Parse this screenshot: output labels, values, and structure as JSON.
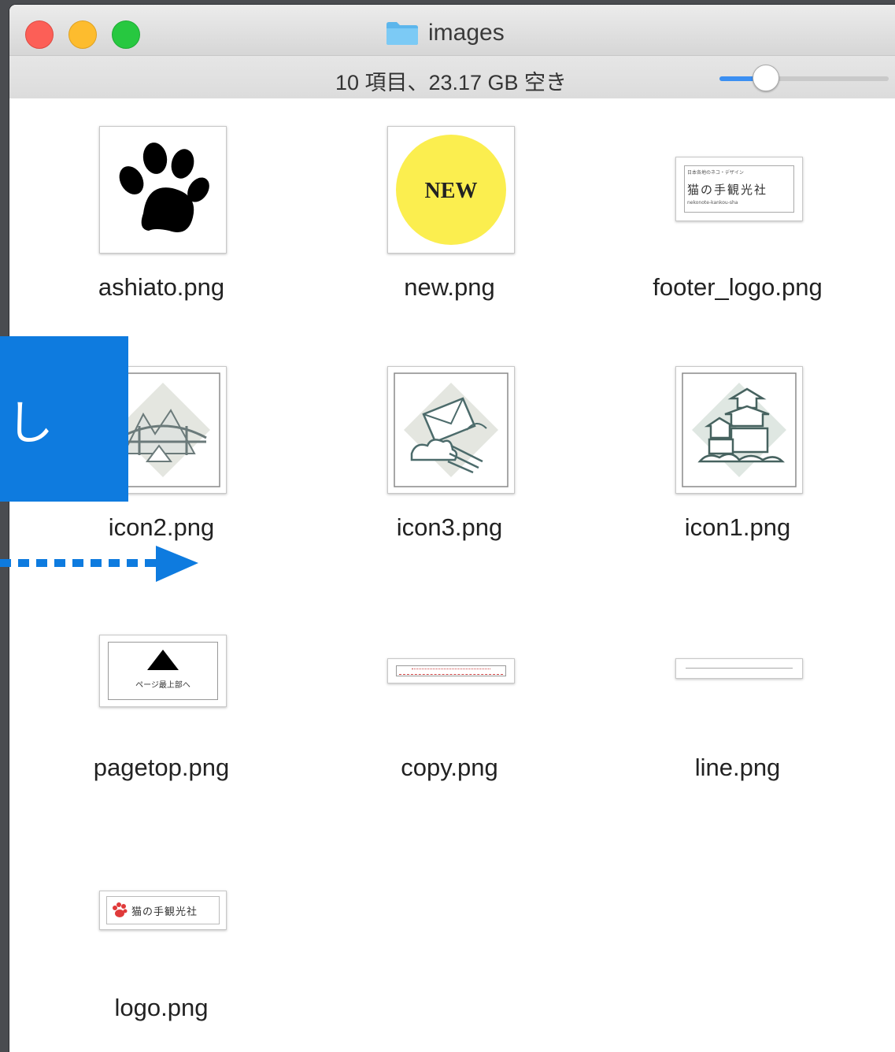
{
  "window": {
    "title": "images",
    "status": "10 項目、23.17 GB 空き",
    "zoom_fraction": 0.27
  },
  "overlay": {
    "text": "し",
    "color": "#0e7bdf"
  },
  "files": [
    {
      "name": "ashiato.png",
      "icon": "paw-print-icon"
    },
    {
      "name": "new.png",
      "icon": "new-badge-icon",
      "badge_text": "NEW"
    },
    {
      "name": "footer_logo.png",
      "icon": "footer-logo-thumbnail"
    },
    {
      "name": "icon2.png",
      "icon": "bridge-mountains-icon"
    },
    {
      "name": "icon3.png",
      "icon": "mail-clouds-icon"
    },
    {
      "name": "icon1.png",
      "icon": "castle-icon"
    },
    {
      "name": "pagetop.png",
      "icon": "pagetop-arrow-icon",
      "thumb_text": "ページ最上部へ"
    },
    {
      "name": "copy.png",
      "icon": "copy-strip-thumbnail"
    },
    {
      "name": "line.png",
      "icon": "line-strip-thumbnail"
    },
    {
      "name": "logo.png",
      "icon": "logo-thumbnail",
      "thumb_text": "猫の手観光社"
    }
  ],
  "footer_logo_text": [
    "日本各地のネコ・デザイン",
    "猫の手観光社",
    "nekonote-kankou-sha"
  ]
}
